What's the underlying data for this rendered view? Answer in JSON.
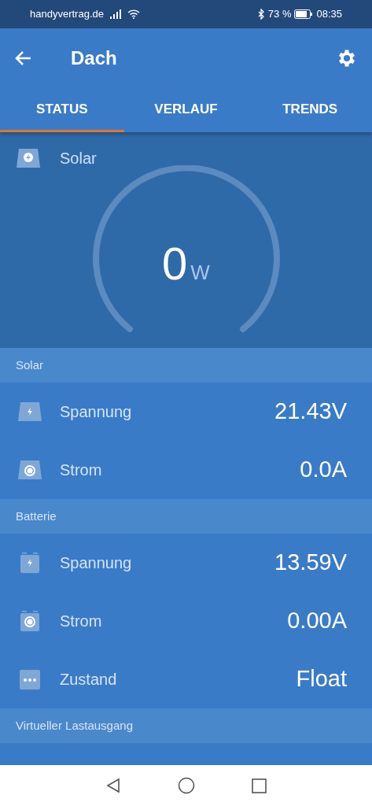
{
  "status_bar": {
    "carrier": "handyvertrag.de",
    "battery": "73 %",
    "time": "08:35"
  },
  "app_bar": {
    "title": "Dach"
  },
  "tabs": [
    {
      "label": "STATUS",
      "selected": true
    },
    {
      "label": "VERLAUF",
      "selected": false
    },
    {
      "label": "TRENDS",
      "selected": false
    }
  ],
  "gauge": {
    "label": "Solar",
    "value": "0",
    "unit": "W"
  },
  "sections": [
    {
      "title": "Solar",
      "rows": [
        {
          "kind": "panel-bolt",
          "label": "Spannung",
          "value": "21.43V"
        },
        {
          "kind": "panel-dot",
          "label": "Strom",
          "value": "0.0A"
        }
      ]
    },
    {
      "title": "Batterie",
      "rows": [
        {
          "kind": "battery-bolt",
          "label": "Spannung",
          "value": "13.59V"
        },
        {
          "kind": "battery-dot",
          "label": "Strom",
          "value": "0.00A"
        },
        {
          "kind": "dots",
          "label": "Zustand",
          "value": "Float"
        }
      ]
    },
    {
      "title": "Virtueller Lastausgang"
    }
  ]
}
